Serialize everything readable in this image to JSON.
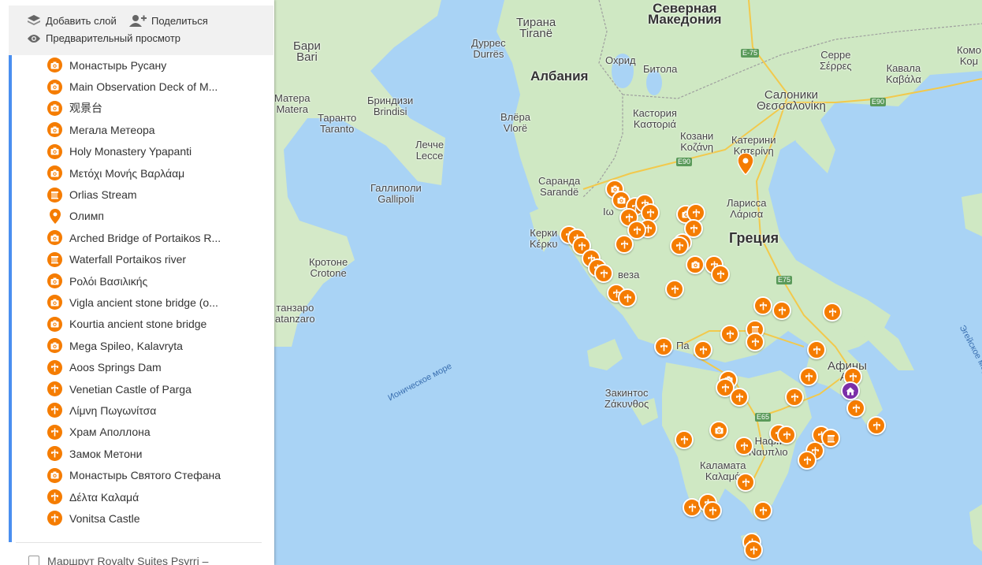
{
  "toolbar": {
    "add_layer": "Добавить слой",
    "share": "Поделиться",
    "preview": "Предварительный просмотр"
  },
  "places": [
    {
      "label": "Монастырь Русану",
      "icon": "camera-icon"
    },
    {
      "label": "Main Observation Deck of M...",
      "icon": "camera-icon"
    },
    {
      "label": "观景台",
      "icon": "camera-icon"
    },
    {
      "label": "Мегала Метеора",
      "icon": "camera-icon"
    },
    {
      "label": "Holy Monastery Ypapanti",
      "icon": "camera-icon"
    },
    {
      "label": "Μετόχι Μονής Βαρλάαμ",
      "icon": "camera-icon"
    },
    {
      "label": "Orlias Stream",
      "icon": "waterfall-icon"
    },
    {
      "label": "Олимп",
      "icon": "pin-icon"
    },
    {
      "label": "Arched Bridge of Portaikos R...",
      "icon": "camera-icon"
    },
    {
      "label": "Waterfall Portaikos river",
      "icon": "waterfall-icon"
    },
    {
      "label": "Ρολόι Βασιλικής",
      "icon": "camera-icon"
    },
    {
      "label": "Vigla ancient stone bridge (o...",
      "icon": "camera-icon"
    },
    {
      "label": "Kourtia ancient stone bridge",
      "icon": "camera-icon"
    },
    {
      "label": "Mega Spileo, Kalavryta",
      "icon": "camera-icon"
    },
    {
      "label": "Aoos Springs Dam",
      "icon": "attraction-icon"
    },
    {
      "label": "Venetian Castle of Parga",
      "icon": "attraction-icon"
    },
    {
      "label": "Λίμνη Πωγωνίτσα",
      "icon": "attraction-icon"
    },
    {
      "label": "Храм Аполлона",
      "icon": "attraction-icon"
    },
    {
      "label": "Замок Метони",
      "icon": "attraction-icon"
    },
    {
      "label": "Монастырь Святого Стефана",
      "icon": "camera-icon"
    },
    {
      "label": "Δέλτα Καλαμά",
      "icon": "attraction-icon"
    },
    {
      "label": "Vonitsa Castle",
      "icon": "attraction-icon"
    }
  ],
  "route_layer": "Маршрут Royalty Suites Psyrri –",
  "map_labels": {
    "north_macedonia": "Северная\nМакедония",
    "tirana": "Тирана\nTiranë",
    "durres": "Дуррес\nDurrës",
    "albania": "Албания",
    "bari": "Бари\nBari",
    "matera": "Матера\nMatera",
    "brindisi": "Бриндизи\nBrindisi",
    "taranto": "Таранто\nTaranto",
    "lecce": "Лечче\nLecce",
    "vlore": "Влёра\nVlorë",
    "gallipoli": "Галлиполи\nGallipoli",
    "sarande": "Саранда\nSarandë",
    "ohrid": "Охрид",
    "bitola": "Битола",
    "kastoria": "Кастория\nΚαστοριά",
    "kozani": "Козани\nΚοζάνη",
    "katerini": "Катерини\nΚατερίνη",
    "thessaloniki": "Салоники\nΘεσσαλονίκη",
    "serres": "Серре\nΣέρρες",
    "kavala": "Кавала\nΚαβάλα",
    "komotini": "Комо\nΚομ",
    "larisa": "Ларисса\nΛάρισα",
    "greece": "Греция",
    "kerkyra": "Керки\nΚέρκυ",
    "crotone": "Кротоне\nCrotone",
    "catanzaro": "тaнзаро\natanzaro",
    "ionian_sea": "Ионическое море",
    "aegean_sea": "Эгейское море",
    "patra": "Па",
    "zakynthos": "Закинтос\nΖάκυνθος",
    "athens": "Афины\nΑθ",
    "nafplio": "Нафп\nΝαυπλιο",
    "kalamata": "Каламата\nΚαλαμά",
    "preveza": "вeза",
    "io": "Ιω"
  },
  "roads": [
    "E-75",
    "E90",
    "E90",
    "E75",
    "E65"
  ],
  "colors": {
    "accent": "#4a8ff0",
    "marker": "#f57c00",
    "home_marker": "#7b2fa8",
    "sea": "#a9d3f5",
    "land": "#cfe8c3"
  }
}
